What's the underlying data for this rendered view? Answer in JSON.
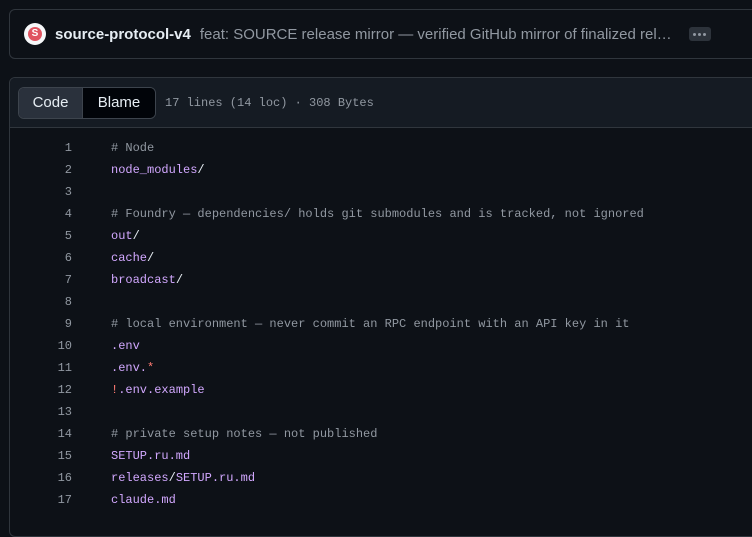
{
  "commit": {
    "avatar_letter": "S",
    "author": "source-protocol-v4",
    "message": "feat: SOURCE release mirror — verified GitHub mirror of finalized release"
  },
  "file": {
    "tabs": [
      "Code",
      "Blame"
    ],
    "active_tab": "Code",
    "meta": "17 lines (14 loc) · 308 Bytes"
  },
  "lines": [
    {
      "n": "1",
      "tokens": [
        {
          "t": "# Node",
          "k": "comment"
        }
      ]
    },
    {
      "n": "2",
      "tokens": [
        {
          "t": "node_modules",
          "k": "path"
        },
        {
          "t": "/",
          "k": "text"
        }
      ]
    },
    {
      "n": "3",
      "tokens": []
    },
    {
      "n": "4",
      "tokens": [
        {
          "t": "# Foundry — dependencies/ holds git submodules and is tracked, not ignored",
          "k": "comment"
        }
      ]
    },
    {
      "n": "5",
      "tokens": [
        {
          "t": "out",
          "k": "path"
        },
        {
          "t": "/",
          "k": "text"
        }
      ]
    },
    {
      "n": "6",
      "tokens": [
        {
          "t": "cache",
          "k": "path"
        },
        {
          "t": "/",
          "k": "text"
        }
      ]
    },
    {
      "n": "7",
      "tokens": [
        {
          "t": "broadcast",
          "k": "path"
        },
        {
          "t": "/",
          "k": "text"
        }
      ]
    },
    {
      "n": "8",
      "tokens": []
    },
    {
      "n": "9",
      "tokens": [
        {
          "t": "# local environment — never commit an RPC endpoint with an API key in it",
          "k": "comment"
        }
      ]
    },
    {
      "n": "10",
      "tokens": [
        {
          "t": ".env",
          "k": "path"
        }
      ]
    },
    {
      "n": "11",
      "tokens": [
        {
          "t": ".env.",
          "k": "path"
        },
        {
          "t": "*",
          "k": "op"
        }
      ]
    },
    {
      "n": "12",
      "tokens": [
        {
          "t": "!",
          "k": "op"
        },
        {
          "t": ".env.example",
          "k": "path"
        }
      ]
    },
    {
      "n": "13",
      "tokens": []
    },
    {
      "n": "14",
      "tokens": [
        {
          "t": "# private setup notes — not published",
          "k": "comment"
        }
      ]
    },
    {
      "n": "15",
      "tokens": [
        {
          "t": "SETUP.ru.md",
          "k": "path"
        }
      ]
    },
    {
      "n": "16",
      "tokens": [
        {
          "t": "releases",
          "k": "path"
        },
        {
          "t": "/",
          "k": "text"
        },
        {
          "t": "SETUP.ru.md",
          "k": "path"
        }
      ]
    },
    {
      "n": "17",
      "tokens": [
        {
          "t": "claude.md",
          "k": "path"
        }
      ]
    }
  ]
}
